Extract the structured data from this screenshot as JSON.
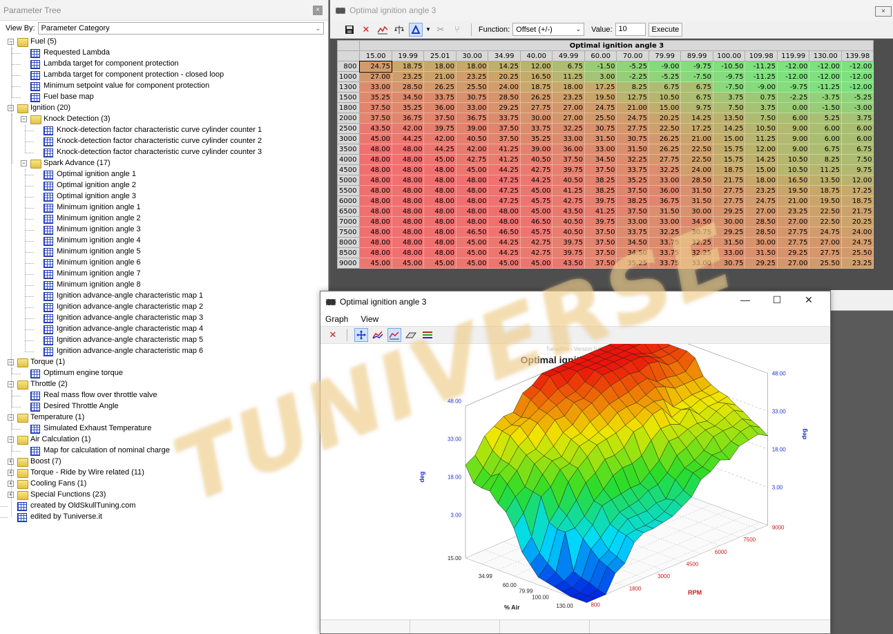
{
  "tree_panel": {
    "title": "Parameter Tree",
    "close_glyph": "×",
    "view_by_label": "View By:",
    "view_by_value": "Parameter Category",
    "nodes": [
      {
        "label": "Fuel (5)",
        "type": "folder-open",
        "level": 0,
        "expander": "−"
      },
      {
        "label": "Requested Lambda",
        "type": "table",
        "level": 1
      },
      {
        "label": "Lambda target for component protection",
        "type": "table",
        "level": 1
      },
      {
        "label": "Lambda target for component protection - closed loop",
        "type": "table",
        "level": 1
      },
      {
        "label": "Minimum setpoint value for component protection",
        "type": "table",
        "level": 1
      },
      {
        "label": "Fuel base map",
        "type": "table",
        "level": 1
      },
      {
        "label": "Ignition (20)",
        "type": "folder-open",
        "level": 0,
        "expander": "−"
      },
      {
        "label": "Knock Detection (3)",
        "type": "folder-open",
        "level": 1,
        "expander": "−"
      },
      {
        "label": "Knock-detection factor characteristic curve cylinder counter 1",
        "type": "table",
        "level": 2
      },
      {
        "label": "Knock-detection factor characteristic curve cylinder counter 2",
        "type": "table",
        "level": 2
      },
      {
        "label": "Knock-detection factor characteristic curve cylinder counter 3",
        "type": "table",
        "level": 2
      },
      {
        "label": "Spark Advance (17)",
        "type": "folder-open",
        "level": 1,
        "expander": "−"
      },
      {
        "label": "Optimal ignition angle 1",
        "type": "table",
        "level": 2
      },
      {
        "label": "Optimal ignition angle 2",
        "type": "table",
        "level": 2
      },
      {
        "label": "Optimal ignition angle 3",
        "type": "table",
        "level": 2
      },
      {
        "label": "Minimum ignition angle 1",
        "type": "table",
        "level": 2
      },
      {
        "label": "Minimum ignition angle 2",
        "type": "table",
        "level": 2
      },
      {
        "label": "Minimum ignition angle 3",
        "type": "table",
        "level": 2
      },
      {
        "label": "Minimum ignition angle 4",
        "type": "table",
        "level": 2
      },
      {
        "label": "Minimum ignition angle 5",
        "type": "table",
        "level": 2
      },
      {
        "label": "Minimum ignition angle 6",
        "type": "table",
        "level": 2
      },
      {
        "label": "Minimum ignition angle 7",
        "type": "table",
        "level": 2
      },
      {
        "label": "Minimum ignition angle 8",
        "type": "table",
        "level": 2
      },
      {
        "label": "Ignition advance-angle characteristic map 1",
        "type": "table",
        "level": 2
      },
      {
        "label": "Ignition advance-angle characteristic map 2",
        "type": "table",
        "level": 2
      },
      {
        "label": "Ignition advance-angle characteristic map 3",
        "type": "table",
        "level": 2
      },
      {
        "label": "Ignition advance-angle characteristic map 4",
        "type": "table",
        "level": 2
      },
      {
        "label": "Ignition advance-angle characteristic map 5",
        "type": "table",
        "level": 2
      },
      {
        "label": "Ignition advance-angle characteristic map 6",
        "type": "table",
        "level": 2
      },
      {
        "label": "Torque (1)",
        "type": "folder-open",
        "level": 0,
        "expander": "−"
      },
      {
        "label": "Optimum engine torque",
        "type": "table",
        "level": 1
      },
      {
        "label": "Throttle (2)",
        "type": "folder-open",
        "level": 0,
        "expander": "−"
      },
      {
        "label": "Real mass flow over throttle valve",
        "type": "table",
        "level": 1
      },
      {
        "label": "Desired Throttle Angle",
        "type": "table",
        "level": 1
      },
      {
        "label": "Temperature (1)",
        "type": "folder-open",
        "level": 0,
        "expander": "−"
      },
      {
        "label": "Simulated Exhaust Temperature",
        "type": "table",
        "level": 1
      },
      {
        "label": "Air Calculation (1)",
        "type": "folder-open",
        "level": 0,
        "expander": "−"
      },
      {
        "label": "Map for calculation of nominal charge",
        "type": "table",
        "level": 1
      },
      {
        "label": "Boost (7)",
        "type": "folder",
        "level": 0,
        "expander": "+"
      },
      {
        "label": "Torque - Ride by Wire related (11)",
        "type": "folder",
        "level": 0,
        "expander": "+"
      },
      {
        "label": "Cooling Fans (1)",
        "type": "folder",
        "level": 0,
        "expander": "+"
      },
      {
        "label": "Special Functions (23)",
        "type": "folder",
        "level": 0,
        "expander": "+"
      },
      {
        "label": "created by OldSkullTuning.com",
        "type": "table",
        "level": 0
      },
      {
        "label": "edited by Tuniverse.it",
        "type": "table",
        "level": 0
      }
    ]
  },
  "table_window": {
    "title": "Optimal ignition angle 3",
    "close_glyph": "×",
    "toolbar": {
      "function_label": "Function:",
      "function_value": "Offset (+/-)",
      "value_label": "Value:",
      "value": "10",
      "execute_label": "Execute"
    },
    "table_title": "Optimal ignition angle 3",
    "columns": [
      "15.00",
      "19.99",
      "25.01",
      "30.00",
      "34.99",
      "40.00",
      "49.99",
      "60.00",
      "70.00",
      "79.99",
      "89.99",
      "100.00",
      "109.98",
      "119.99",
      "130.00",
      "139.98"
    ],
    "rows": [
      {
        "rpm": "800",
        "values": [
          "24.75",
          "18.75",
          "18.00",
          "18.00",
          "14.25",
          "12.00",
          "6.75",
          "-1.50",
          "-5.25",
          "-9.00",
          "-9.75",
          "-10.50",
          "-11.25",
          "-12.00",
          "-12.00",
          "-12.00"
        ]
      },
      {
        "rpm": "1000",
        "values": [
          "27.00",
          "23.25",
          "21.00",
          "23.25",
          "20.25",
          "16.50",
          "11.25",
          "3.00",
          "-2.25",
          "-5.25",
          "-7.50",
          "-9.75",
          "-11.25",
          "-12.00",
          "-12.00",
          "-12.00"
        ]
      },
      {
        "rpm": "1300",
        "values": [
          "33.00",
          "28.50",
          "26.25",
          "25.50",
          "24.00",
          "18.75",
          "18.00",
          "17.25",
          "8.25",
          "6.75",
          "6.75",
          "-7.50",
          "-9.00",
          "-9.75",
          "-11.25",
          "-12.00"
        ]
      },
      {
        "rpm": "1500",
        "values": [
          "35.25",
          "34.50",
          "33.75",
          "30.75",
          "28.50",
          "26.25",
          "23.25",
          "19.50",
          "12.75",
          "10.50",
          "6.75",
          "3.75",
          "0.75",
          "-2.25",
          "-3.75",
          "-5.25"
        ]
      },
      {
        "rpm": "1800",
        "values": [
          "37.50",
          "35.25",
          "36.00",
          "33.00",
          "29.25",
          "27.75",
          "27.00",
          "24.75",
          "21.00",
          "15.00",
          "9.75",
          "7.50",
          "3.75",
          "0.00",
          "-1.50",
          "-3.00"
        ]
      },
      {
        "rpm": "2000",
        "values": [
          "37.50",
          "36.75",
          "37.50",
          "36.75",
          "33.75",
          "30.00",
          "27.00",
          "25.50",
          "24.75",
          "20.25",
          "14.25",
          "13.50",
          "7.50",
          "6.00",
          "5.25",
          "3.75"
        ]
      },
      {
        "rpm": "2500",
        "values": [
          "43.50",
          "42.00",
          "39.75",
          "39.00",
          "37.50",
          "33.75",
          "32.25",
          "30.75",
          "27.75",
          "22.50",
          "17.25",
          "14.25",
          "10.50",
          "9.00",
          "6.00",
          "6.00"
        ]
      },
      {
        "rpm": "3000",
        "values": [
          "45.00",
          "44.25",
          "42.00",
          "40.50",
          "37.50",
          "35.25",
          "33.00",
          "31.50",
          "30.75",
          "26.25",
          "21.00",
          "15.00",
          "11.25",
          "9.00",
          "6.00",
          "6.00"
        ]
      },
      {
        "rpm": "3500",
        "values": [
          "48.00",
          "48.00",
          "44.25",
          "42.00",
          "41.25",
          "39.00",
          "36.00",
          "33.00",
          "31.50",
          "26.25",
          "22.50",
          "15.75",
          "12.00",
          "9.00",
          "6.75",
          "6.75"
        ]
      },
      {
        "rpm": "4000",
        "values": [
          "48.00",
          "48.00",
          "45.00",
          "42.75",
          "41.25",
          "40.50",
          "37.50",
          "34.50",
          "32.25",
          "27.75",
          "22.50",
          "15.75",
          "14.25",
          "10.50",
          "8.25",
          "7.50"
        ]
      },
      {
        "rpm": "4500",
        "values": [
          "48.00",
          "48.00",
          "48.00",
          "45.00",
          "44.25",
          "42.75",
          "39.75",
          "37.50",
          "33.75",
          "32.25",
          "24.00",
          "18.75",
          "15.00",
          "10.50",
          "11.25",
          "9.75"
        ]
      },
      {
        "rpm": "5000",
        "values": [
          "48.00",
          "48.00",
          "48.00",
          "48.00",
          "47.25",
          "44.25",
          "40.50",
          "38.25",
          "35.25",
          "33.00",
          "28.50",
          "21.75",
          "18.00",
          "16.50",
          "13.50",
          "12.00"
        ]
      },
      {
        "rpm": "5500",
        "values": [
          "48.00",
          "48.00",
          "48.00",
          "48.00",
          "47.25",
          "45.00",
          "41.25",
          "38.25",
          "37.50",
          "36.00",
          "31.50",
          "27.75",
          "23.25",
          "19.50",
          "18.75",
          "17.25"
        ]
      },
      {
        "rpm": "6000",
        "values": [
          "48.00",
          "48.00",
          "48.00",
          "48.00",
          "47.25",
          "45.75",
          "42.75",
          "39.75",
          "38.25",
          "36.75",
          "31.50",
          "27.75",
          "24.75",
          "21.00",
          "19.50",
          "18.75"
        ]
      },
      {
        "rpm": "6500",
        "values": [
          "48.00",
          "48.00",
          "48.00",
          "48.00",
          "48.00",
          "45.00",
          "43.50",
          "41.25",
          "37.50",
          "31.50",
          "30.00",
          "29.25",
          "27.00",
          "23.25",
          "22.50",
          "21.75"
        ]
      },
      {
        "rpm": "7000",
        "values": [
          "48.00",
          "48.00",
          "48.00",
          "48.00",
          "48.00",
          "46.50",
          "40.50",
          "39.75",
          "33.00",
          "33.00",
          "34.50",
          "30.00",
          "28.50",
          "27.00",
          "22.50",
          "20.25"
        ]
      },
      {
        "rpm": "7500",
        "values": [
          "48.00",
          "48.00",
          "48.00",
          "46.50",
          "46.50",
          "45.75",
          "40.50",
          "37.50",
          "33.75",
          "32.25",
          "30.75",
          "29.25",
          "28.50",
          "27.75",
          "24.75",
          "24.00"
        ]
      },
      {
        "rpm": "8000",
        "values": [
          "48.00",
          "48.00",
          "48.00",
          "45.00",
          "44.25",
          "42.75",
          "39.75",
          "37.50",
          "34.50",
          "33.75",
          "32.25",
          "31.50",
          "30.00",
          "27.75",
          "27.00",
          "24.75"
        ]
      },
      {
        "rpm": "8500",
        "values": [
          "48.00",
          "48.00",
          "48.00",
          "45.00",
          "44.25",
          "42.75",
          "39.75",
          "37.50",
          "34.50",
          "33.75",
          "32.25",
          "33.00",
          "31.50",
          "29.25",
          "27.75",
          "25.50"
        ]
      },
      {
        "rpm": "9000",
        "values": [
          "45.00",
          "45.00",
          "45.00",
          "45.00",
          "45.00",
          "45.00",
          "43.50",
          "37.50",
          "35.25",
          "33.75",
          "33.00",
          "30.75",
          "29.25",
          "27.00",
          "25.50",
          "23.25"
        ]
      }
    ]
  },
  "graph_window": {
    "title": "Optimal ignition angle 3",
    "controls": [
      "—",
      "☐",
      "✕"
    ],
    "menu": [
      "Graph",
      "View"
    ],
    "version_text": "TunerPro - Version 5.00",
    "plot_title": "Optimal ignition angle 3",
    "z_ticks_left": [
      "48.00",
      "33.00",
      "18.00",
      "3.00"
    ],
    "z_ticks_right": [
      "48.00",
      "33.00",
      "18.00",
      "3.00"
    ],
    "z_left_offset_ticks": [
      "15.00"
    ],
    "z_label": "deg",
    "x_label": "% Air",
    "x_ticks": [
      "34.99",
      "60.00",
      "79.99",
      "100.00",
      "130.00"
    ],
    "y_label": "RPM",
    "y_ticks": [
      "9000",
      "7500",
      "6000",
      "4500",
      "3000",
      "1800",
      "800"
    ]
  },
  "watermark_text": "TUNIVERSE",
  "colors": {
    "high": "#f07070",
    "mid": "#c8a86a",
    "low": "#7ee07e",
    "axis_blue": "#1a33cc",
    "axis_red": "#cc1a1a"
  }
}
